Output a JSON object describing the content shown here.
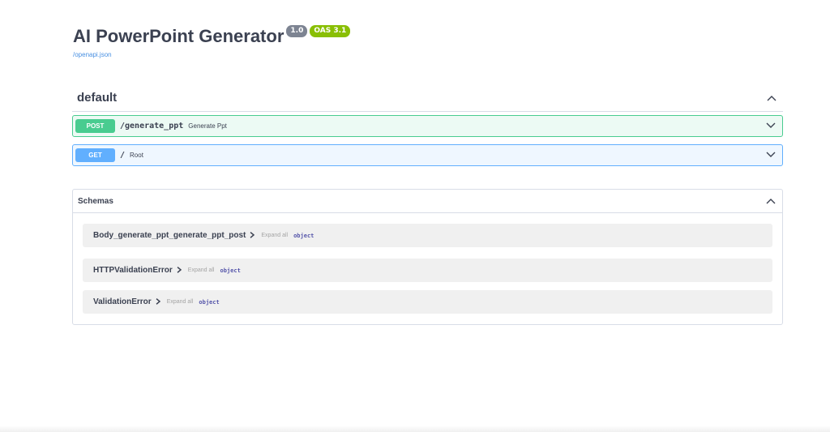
{
  "info": {
    "title": "AI PowerPoint Generator",
    "version": "1.0",
    "oas": "OAS 3.1",
    "spec_link": "/openapi.json"
  },
  "tag": {
    "name": "default",
    "operations": [
      {
        "method": "POST",
        "path": "/generate_ppt",
        "summary": "Generate Ppt"
      },
      {
        "method": "GET",
        "path": "/",
        "summary": "Root"
      }
    ]
  },
  "schemas": {
    "title": "Schemas",
    "models": [
      {
        "name": "Body_generate_ppt_generate_ppt_post",
        "expand_label": "Expand all",
        "type": "object"
      },
      {
        "name": "HTTPValidationError",
        "expand_label": "Expand all",
        "type": "object"
      },
      {
        "name": "ValidationError",
        "expand_label": "Expand all",
        "type": "object"
      }
    ]
  },
  "colors": {
    "post": "#49cc90",
    "get": "#61affe",
    "version_badge": "#7d8492",
    "oas_badge": "#89bf04",
    "link": "#4990e2"
  },
  "icons": {
    "collapse": "chevron-up-icon",
    "expand": "chevron-down-icon",
    "model_toggle": "chevron-right-icon"
  }
}
